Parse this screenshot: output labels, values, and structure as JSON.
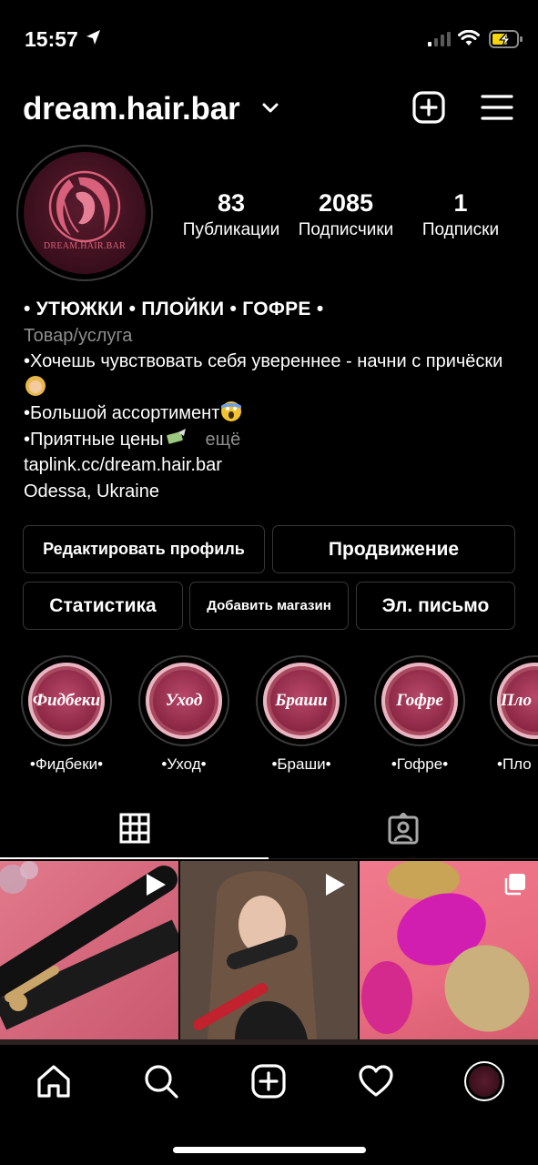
{
  "status_bar": {
    "time": "15:57",
    "icons": [
      "location-arrow-icon",
      "cellular-signal-icon",
      "wifi-icon",
      "battery-charging-icon"
    ],
    "battery_color": "#f5d60a"
  },
  "header": {
    "username": "dream.hair.bar",
    "icons": [
      "chevron-down-icon",
      "new-post-icon",
      "menu-icon"
    ]
  },
  "avatar": {
    "logo_text": "DREAM.HAIR.BAR"
  },
  "stats": {
    "posts": {
      "value": "83",
      "label": "Публикации"
    },
    "followers": {
      "value": "2085",
      "label": "Подписчики"
    },
    "following": {
      "value": "1",
      "label": "Подписки"
    }
  },
  "bio": {
    "name": "• УТЮЖКИ • ПЛОЙКИ • ГОФРЕ •",
    "category": "Товар/услуга",
    "line1": "•Хочешь чувствовать себя увереннее - начни с причёски",
    "line2": "•Большой ассортимент",
    "line3": "•Приятные цены",
    "more": "ещё",
    "link": "taplink.cc/dream.hair.bar",
    "location": "Odessa, Ukraine"
  },
  "buttons": {
    "edit_profile": "Редактировать профиль",
    "promotion": "Продвижение",
    "statistics": "Статистика",
    "add_shop": "Добавить магазин",
    "email": "Эл. письмо"
  },
  "highlights": [
    {
      "title": "Фидбеки",
      "label": "•Фидбеки•"
    },
    {
      "title": "Уход",
      "label": "•Уход•"
    },
    {
      "title": "Браши",
      "label": "•Браши•"
    },
    {
      "title": "Гофре",
      "label": "•Гофре•"
    },
    {
      "title": "Пло",
      "label": "•Пло"
    }
  ],
  "tabs": [
    "grid-icon",
    "tagged-icon"
  ],
  "tab_bar": [
    "home-icon",
    "search-icon",
    "add-post-icon",
    "heart-icon",
    "profile-avatar"
  ],
  "colors": {
    "background": "#000000",
    "secondary_text": "#8e8e8e",
    "button_border": "#363636",
    "brand_pink": "#d9607a"
  }
}
